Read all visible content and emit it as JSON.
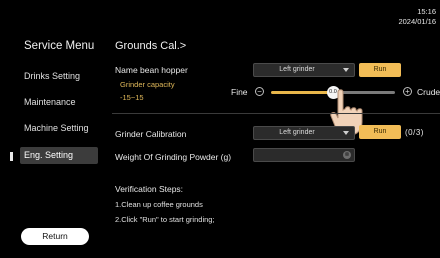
{
  "clock": {
    "time": "15:16",
    "date": "2024/01/16"
  },
  "sidebar": {
    "title": "Service Menu",
    "items": [
      {
        "label": "Drinks Setting"
      },
      {
        "label": "Maintenance"
      },
      {
        "label": "Machine Setting"
      },
      {
        "label": "Eng. Setting",
        "active": true
      }
    ],
    "return_label": "Return"
  },
  "main": {
    "title": "Grounds Cal.>",
    "bean_hopper": {
      "label": "Name bean hopper",
      "select_value": "Left grinder",
      "run_label": "Run"
    },
    "grinder_capacity": {
      "label": "Grinder capacity",
      "range": "-15~15",
      "fine_label": "Fine",
      "crude_label": "Crude",
      "value_text": "0.0",
      "value": 0.0,
      "min": -15,
      "max": 15
    },
    "calibration": {
      "label": "Grinder Calibration",
      "select_value": "Left grinder",
      "run_label": "Run",
      "counter": "(0/3)"
    },
    "weight": {
      "label": "Weight Of Grinding Powder (g)",
      "value": ""
    },
    "verification": {
      "title": "Verification Steps:",
      "steps": [
        "1.Clean up coffee grounds",
        "2.Click \"Run\" to start grinding;"
      ]
    }
  },
  "colors": {
    "accent": "#f2bd57",
    "background": "#000000",
    "active_item": "#3c3c3c"
  },
  "icons": [
    "chevron-down-icon",
    "minus-circle-icon",
    "plus-circle-icon",
    "clear-icon",
    "hand-pointer-icon"
  ]
}
